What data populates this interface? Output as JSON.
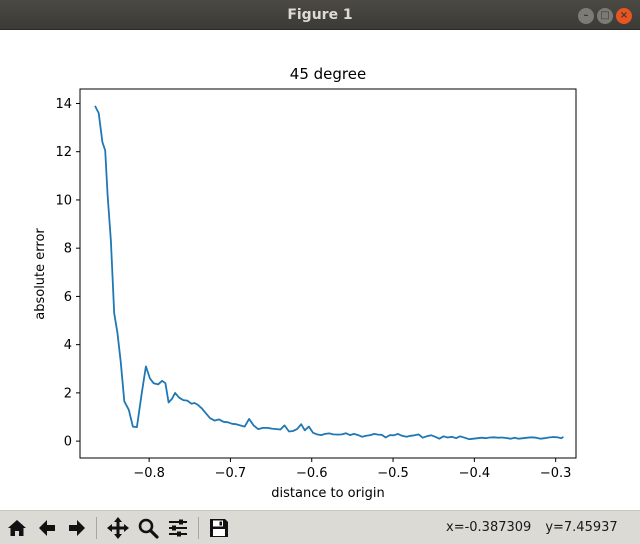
{
  "window": {
    "title": "Figure 1"
  },
  "toolbar": {
    "icons": [
      "home-icon",
      "back-arrow-icon",
      "forward-arrow-icon",
      "pan-icon",
      "zoom-icon",
      "subplots-icon",
      "save-icon"
    ],
    "x_readout": "x=-0.387309",
    "y_readout": "y=7.45937"
  },
  "colors": {
    "line": "#1f77b4",
    "titlebar": "#3c3b37",
    "toolbar": "#dcdad5"
  },
  "chart_data": {
    "type": "line",
    "title": "45 degree",
    "xlabel": "distance to origin",
    "ylabel": "absolute error",
    "xlim": [
      -0.885,
      -0.275
    ],
    "ylim": [
      -0.7,
      14.6
    ],
    "xticks": [
      -0.8,
      -0.7,
      -0.6,
      -0.5,
      -0.4,
      -0.3
    ],
    "xtick_labels": [
      "−0.8",
      "−0.7",
      "−0.6",
      "−0.5",
      "−0.4",
      "−0.3"
    ],
    "yticks": [
      0,
      2,
      4,
      6,
      8,
      10,
      12,
      14
    ],
    "ytick_labels": [
      "0",
      "2",
      "4",
      "6",
      "8",
      "10",
      "12",
      "14"
    ],
    "grid": false,
    "series": [
      {
        "x": [
          -0.8665,
          -0.862,
          -0.8575,
          -0.854,
          -0.851,
          -0.847,
          -0.843,
          -0.839,
          -0.835,
          -0.8305,
          -0.825,
          -0.82,
          -0.815,
          -0.809,
          -0.804,
          -0.799,
          -0.7945,
          -0.789,
          -0.784,
          -0.78,
          -0.776,
          -0.772,
          -0.768,
          -0.763,
          -0.758,
          -0.753,
          -0.748,
          -0.744,
          -0.74,
          -0.735,
          -0.73,
          -0.725,
          -0.7195,
          -0.714,
          -0.7085,
          -0.703,
          -0.698,
          -0.693,
          -0.688,
          -0.6825,
          -0.677,
          -0.6715,
          -0.666,
          -0.66,
          -0.6545,
          -0.649,
          -0.6435,
          -0.6385,
          -0.6335,
          -0.628,
          -0.623,
          -0.618,
          -0.613,
          -0.6085,
          -0.6035,
          -0.5985,
          -0.5935,
          -0.5885,
          -0.5835,
          -0.5785,
          -0.5735,
          -0.568,
          -0.563,
          -0.558,
          -0.553,
          -0.548,
          -0.543,
          -0.538,
          -0.533,
          -0.528,
          -0.523,
          -0.5185,
          -0.514,
          -0.509,
          -0.504,
          -0.499,
          -0.494,
          -0.489,
          -0.4835,
          -0.4785,
          -0.4735,
          -0.4685,
          -0.4635,
          -0.4585,
          -0.453,
          -0.448,
          -0.443,
          -0.438,
          -0.433,
          -0.4275,
          -0.4225,
          -0.4175,
          -0.412,
          -0.4065,
          -0.401,
          -0.396,
          -0.391,
          -0.386,
          -0.381,
          -0.376,
          -0.371,
          -0.366,
          -0.361,
          -0.3555,
          -0.3505,
          -0.3455,
          -0.34,
          -0.335,
          -0.3295,
          -0.324,
          -0.3185,
          -0.3135,
          -0.3085,
          -0.303,
          -0.298,
          -0.293,
          -0.2905
        ],
        "y": [
          13.9,
          13.6,
          12.4,
          12.05,
          10.2,
          8.3,
          5.3,
          4.5,
          3.3,
          1.65,
          1.3,
          0.6,
          0.58,
          2.0,
          3.1,
          2.6,
          2.4,
          2.35,
          2.5,
          2.4,
          1.6,
          1.75,
          2.0,
          1.8,
          1.7,
          1.68,
          1.55,
          1.58,
          1.5,
          1.35,
          1.15,
          0.95,
          0.85,
          0.9,
          0.8,
          0.78,
          0.72,
          0.7,
          0.65,
          0.6,
          0.92,
          0.65,
          0.5,
          0.55,
          0.55,
          0.52,
          0.5,
          0.48,
          0.65,
          0.4,
          0.42,
          0.5,
          0.7,
          0.45,
          0.6,
          0.35,
          0.28,
          0.25,
          0.3,
          0.32,
          0.28,
          0.27,
          0.28,
          0.33,
          0.25,
          0.3,
          0.25,
          0.18,
          0.22,
          0.25,
          0.3,
          0.27,
          0.26,
          0.15,
          0.25,
          0.24,
          0.3,
          0.22,
          0.18,
          0.22,
          0.24,
          0.28,
          0.14,
          0.2,
          0.24,
          0.18,
          0.1,
          0.2,
          0.15,
          0.18,
          0.12,
          0.2,
          0.14,
          0.08,
          0.1,
          0.12,
          0.14,
          0.12,
          0.15,
          0.16,
          0.14,
          0.15,
          0.13,
          0.1,
          0.14,
          0.1,
          0.12,
          0.14,
          0.16,
          0.14,
          0.1,
          0.12,
          0.15,
          0.17,
          0.16,
          0.12,
          0.18
        ]
      }
    ]
  }
}
